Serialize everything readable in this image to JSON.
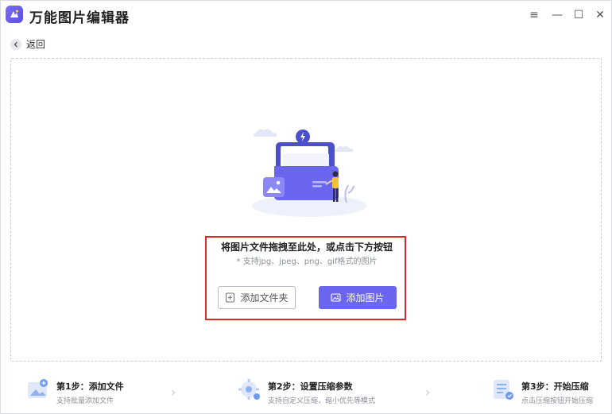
{
  "app": {
    "title": "万能图片编辑器"
  },
  "window_controls": {
    "menu": "≡",
    "minimize": "—",
    "maximize": "☐",
    "close": "✕"
  },
  "nav": {
    "back_label": "返回"
  },
  "dropzone": {
    "title": "将图片文件拖拽至此处，或点击下方按钮",
    "hint": "* 支持jpg、jpeg、png、gif格式的图片",
    "add_folder_label": "添加文件夹",
    "add_image_label": "添加图片"
  },
  "steps": [
    {
      "title": "第1步：添加文件",
      "desc": "支持批量添加文件"
    },
    {
      "title": "第2步：设置压缩参数",
      "desc": "支持自定义压缩，缩小优先等模式"
    },
    {
      "title": "第3步：开始压缩",
      "desc": "点击压缩按钮开始压缩"
    }
  ],
  "colors": {
    "accent": "#6a66f0",
    "highlight": "#e02626"
  }
}
